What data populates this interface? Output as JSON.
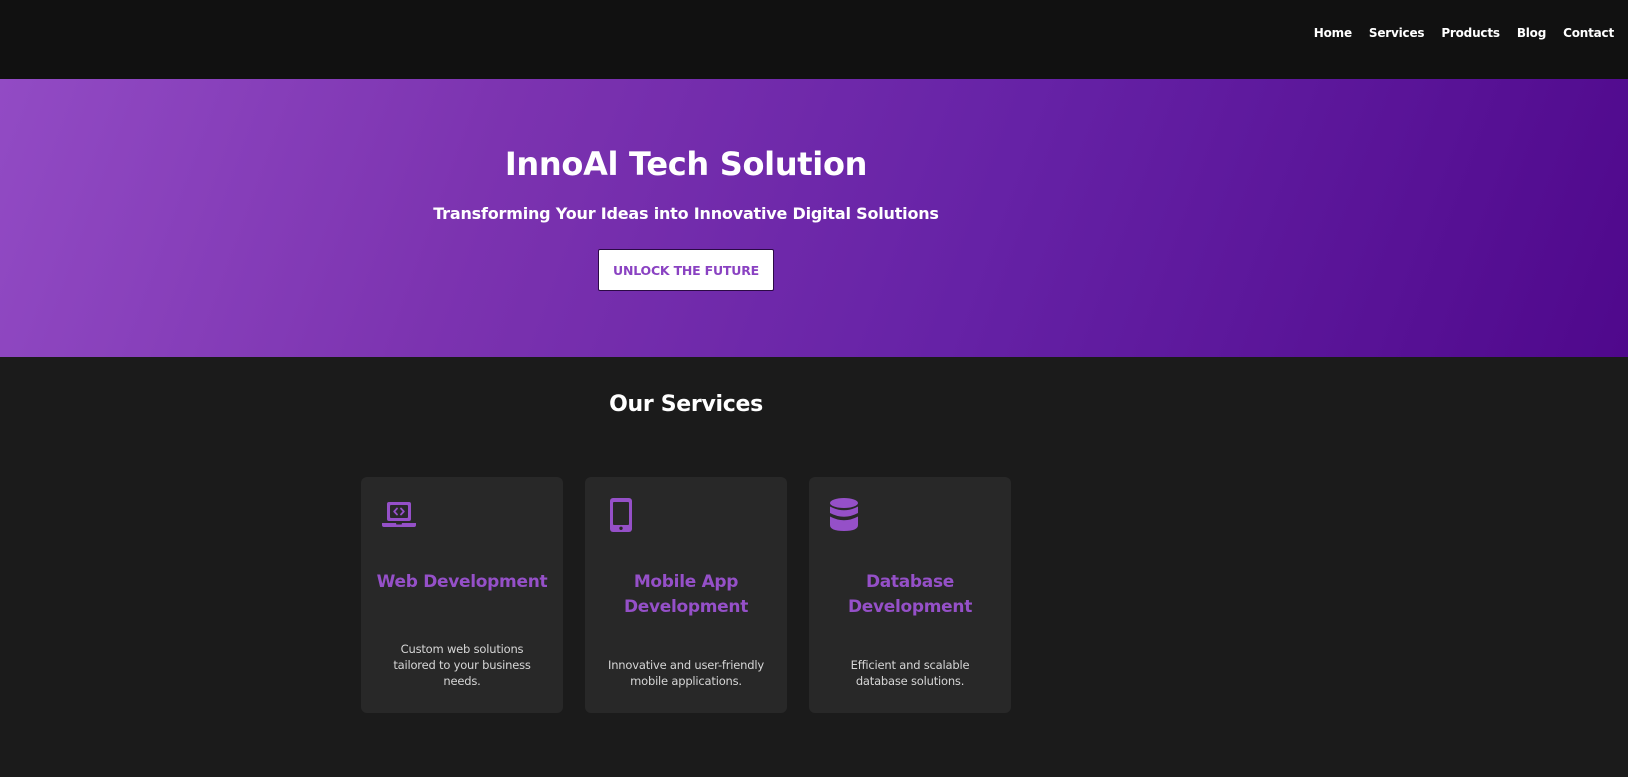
{
  "nav": {
    "items": [
      "Home",
      "Services",
      "Products",
      "Blog",
      "Contact"
    ]
  },
  "hero": {
    "title": "InnoAl Tech Solution",
    "subtitle": "Transforming Your Ideas into Innovative Digital Solutions",
    "cta_label": "UNLOCK THE FUTURE"
  },
  "services": {
    "heading": "Our Services",
    "cards": [
      {
        "icon": "laptop-code-icon",
        "title": "Web Development",
        "description": "Custom web solutions tailored to your business needs."
      },
      {
        "icon": "mobile-phone-icon",
        "title": "Mobile App Development",
        "description": "Innovative and user-friendly mobile applications."
      },
      {
        "icon": "database-icon",
        "title": "Database Development",
        "description": "Efficient and scalable database solutions."
      }
    ]
  },
  "colors": {
    "accent": "#9550c8",
    "header_bg": "#111111",
    "page_bg": "#1b1b1b",
    "card_bg": "#282828",
    "hero_gradient_start": "#924bc4",
    "hero_gradient_end": "#4f088c"
  }
}
